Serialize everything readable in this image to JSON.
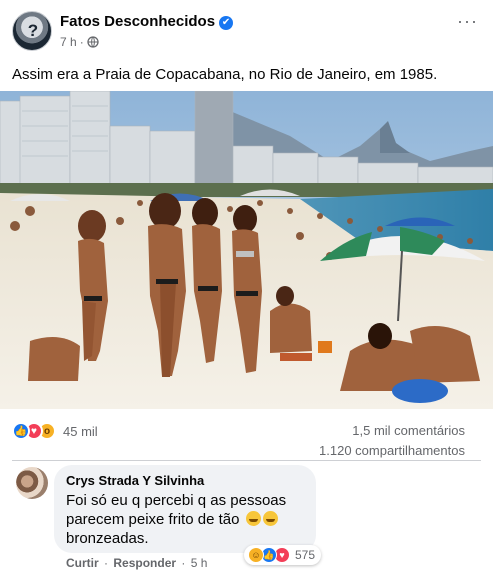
{
  "post": {
    "page_name": "Fatos Desconhecidos",
    "verified_mark": "✔",
    "time": "7 h",
    "dot": "·",
    "more_label": "···",
    "caption": "Assim era a Praia de Copacabana, no Rio de Janeiro, em 1985.",
    "icons": {
      "verified": "verified-badge-icon",
      "privacy": "globe-icon",
      "more": "more-horizontal-icon"
    }
  },
  "stats": {
    "reactions_count": "45 mil",
    "comments_count": "1,5 mil comentários",
    "shares_count": "1.120 compartilhamentos",
    "reaction_types": [
      "like",
      "love",
      "wow"
    ]
  },
  "comment": {
    "author": "Crys Strada Y Silvinha",
    "text": "Foi só eu q percebi q as pessoas parecem peixe frito de tão",
    "text_end": "bronzeadas.",
    "emojis": [
      "hot-face-emoji",
      "hot-face-emoji"
    ],
    "reactions_count": "575",
    "reaction_types": [
      "haha",
      "like",
      "love"
    ],
    "actions": {
      "like": "Curtir",
      "reply": "Responder",
      "separator": "·",
      "time": "5 h"
    }
  },
  "colors": {
    "brand_blue": "#1877f2",
    "text_primary": "#050505",
    "text_secondary": "#65676b",
    "bubble_bg": "#f0f2f5",
    "love_red": "#f33e58",
    "wow_yellow": "#f7b125"
  }
}
